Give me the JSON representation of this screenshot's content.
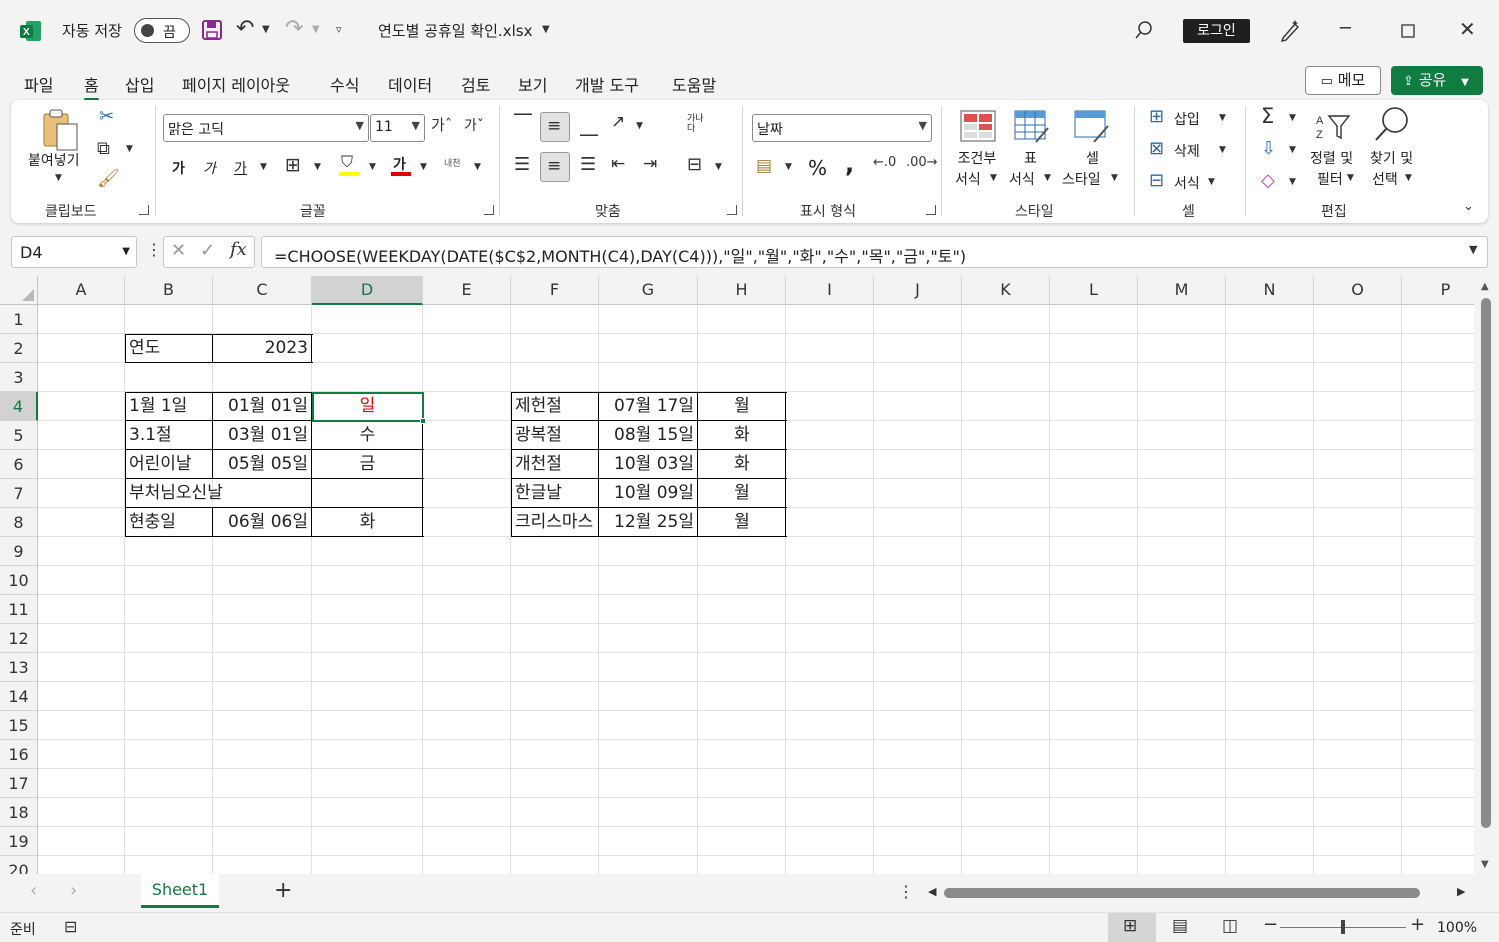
{
  "titlebar": {
    "autosave_label": "자동 저장",
    "autosave_state": "끔",
    "filename": "연도별 공휴일 확인.xlsx",
    "login_label": "로그인"
  },
  "menu": {
    "items": [
      "파일",
      "홈",
      "삽입",
      "페이지 레이아웃",
      "수식",
      "데이터",
      "검토",
      "보기",
      "개발 도구",
      "도움말"
    ],
    "memo_label": "메모",
    "share_label": "공유"
  },
  "ribbon": {
    "paste_label": "붙여넣기",
    "clipboard_group": "클립보드",
    "font_name": "맑은 고딕",
    "font_size": "11",
    "font_group": "글꼴",
    "bold": "가",
    "italic": "가",
    "underline": "가",
    "font_color": "가",
    "phonetic": "내천",
    "align_group": "맞춤",
    "wrap_label": "가나다",
    "number_format": "날짜",
    "number_group": "표시 형식",
    "percent": "%",
    "comma": ",",
    "cond_format_label": [
      "조건부",
      "서식"
    ],
    "table_format_label": [
      "표",
      "서식"
    ],
    "cell_style_label": [
      "셀",
      "스타일"
    ],
    "style_group": "스타일",
    "insert_label": "삽입",
    "delete_label": "삭제",
    "format_label": "서식",
    "cells_group": "셀",
    "sort_label": [
      "정렬 및",
      "필터"
    ],
    "find_label": [
      "찾기 및",
      "선택"
    ],
    "editing_group": "편집"
  },
  "formula_bar": {
    "name_box": "D4",
    "formula": "=CHOOSE(WEEKDAY(DATE($C$2,MONTH(C4),DAY(C4))),\"일\",\"월\",\"화\",\"수\",\"목\",\"금\",\"토\")"
  },
  "grid": {
    "columns": [
      "A",
      "B",
      "C",
      "D",
      "E",
      "F",
      "G",
      "H",
      "I",
      "J",
      "K",
      "L",
      "M",
      "N",
      "O",
      "P"
    ],
    "rows": [
      "1",
      "2",
      "3",
      "4",
      "5",
      "6",
      "7",
      "8",
      "9",
      "10",
      "11",
      "12",
      "13",
      "14",
      "15",
      "16",
      "17",
      "18",
      "19",
      "20"
    ],
    "selected_cell": "D4",
    "cells": {
      "B2": "연도",
      "C2": "2023",
      "B4": "1월 1일",
      "C4": "01월 01일",
      "D4": "일",
      "B5": "3.1절",
      "C5": "03월 01일",
      "D5": "수",
      "B6": "어린이날",
      "C6": "05월 05일",
      "D6": "금",
      "B7": "부처님오신날",
      "B8": "현충일",
      "C8": "06월 06일",
      "D8": "화",
      "F4": "제헌절",
      "G4": "07월 17일",
      "H4": "월",
      "F5": "광복절",
      "G5": "08월 15일",
      "H5": "화",
      "F6": "개천절",
      "G6": "10월 03일",
      "H6": "화",
      "F7": "한글날",
      "G7": "10월 09일",
      "H7": "월",
      "F8": "크리스마스",
      "G8": "12월 25일",
      "H8": "월"
    },
    "sunday_color": "#e00000"
  },
  "sheets": {
    "tabs": [
      "Sheet1"
    ],
    "add_label": "+"
  },
  "status": {
    "ready": "준비",
    "zoom": "100%"
  },
  "colors": {
    "accent": "#107c41"
  }
}
